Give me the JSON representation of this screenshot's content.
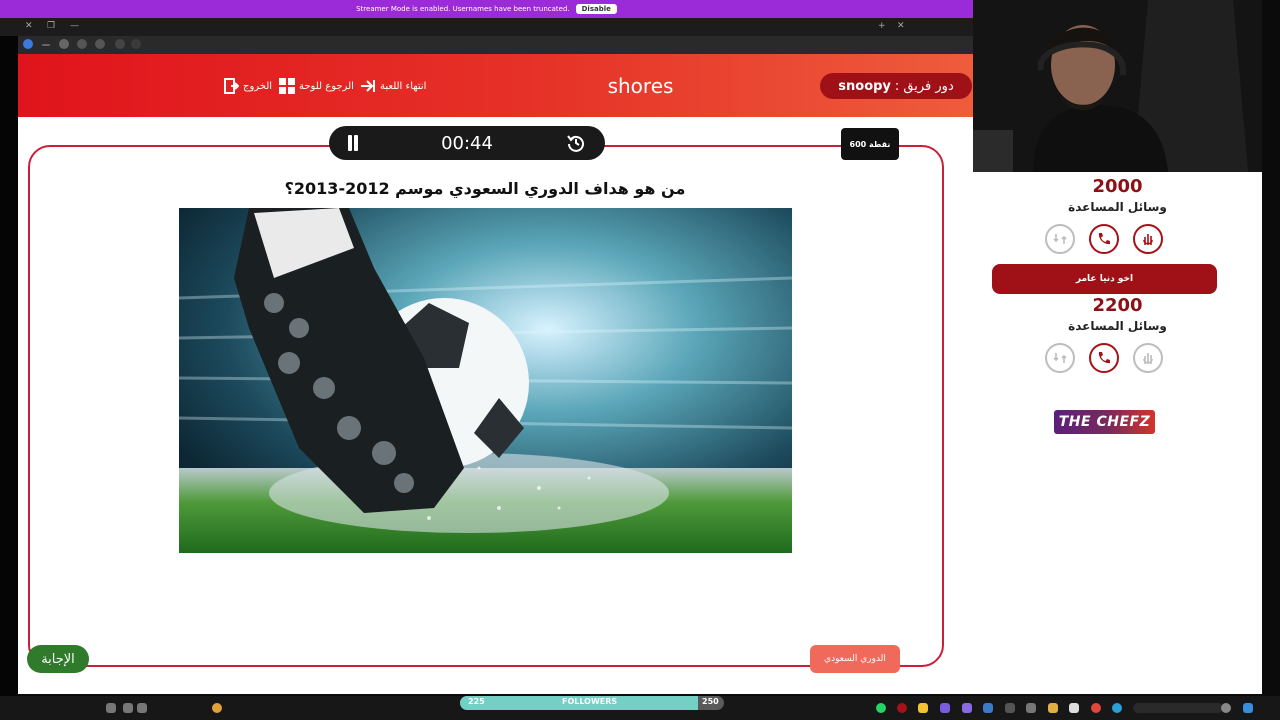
{
  "streamer_banner": {
    "message": "Streamer Mode is enabled. Usernames have been truncated.",
    "disable_label": "Disable"
  },
  "header": {
    "team_turn_label": "دور فريق :",
    "team_turn_name": "snoopy",
    "title": "shores",
    "end_game_label": "انتهاء اللعبة",
    "back_to_board_label": "الرجوع للوحة",
    "exit_label": "الخروج"
  },
  "timer": {
    "time": "00:44"
  },
  "question": {
    "points": "600 نقطة",
    "text": "من هو هداف الدوري السعودي موسم 2012-2013؟",
    "answer_label": "الإجابة",
    "category": "الدوري السعودي"
  },
  "teams": [
    {
      "score": "2000",
      "aids_label": "وسائل المساعدة",
      "aids": [
        {
          "icon": "two-answers-icon",
          "used": false
        },
        {
          "icon": "phone-icon",
          "used": false
        },
        {
          "icon": "swap-icon",
          "used": true
        }
      ]
    },
    {
      "name": "اخو دنيا عامر",
      "score": "2200",
      "aids_label": "وسائل المساعدة",
      "aids": [
        {
          "icon": "two-answers-icon",
          "used": true
        },
        {
          "icon": "phone-icon",
          "used": false
        },
        {
          "icon": "swap-icon",
          "used": true
        }
      ]
    }
  ],
  "logo_text": "THE CHEFZ",
  "taskbar": {
    "followers_label": "FOLLOWERS",
    "followers_current": "225",
    "followers_goal": "250",
    "followers_progress": 0.9
  },
  "colors": {
    "header_red": "#e0141c",
    "pill_dark_red": "#a01117",
    "board_border": "#c8203a",
    "answer_green": "#2f7a2b",
    "category_coral": "#ef6a5a",
    "streamer_purple": "#9b2bd8"
  }
}
